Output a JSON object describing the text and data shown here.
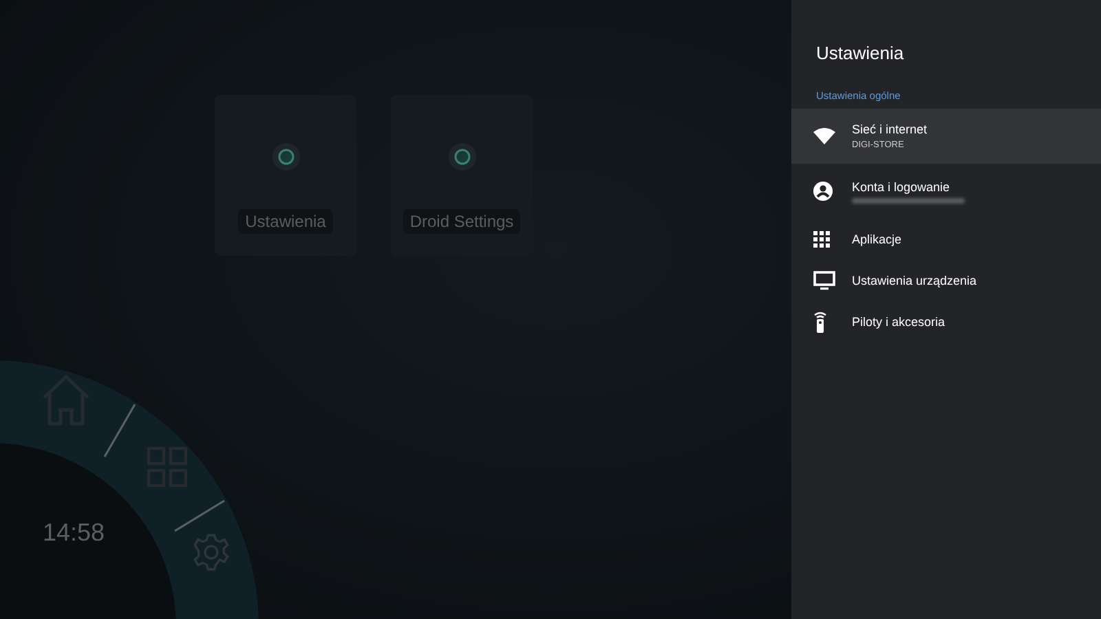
{
  "apps": [
    {
      "label": "Ustawienia"
    },
    {
      "label": "Droid Settings"
    }
  ],
  "radial_menu": {
    "clock": "14:58"
  },
  "settings": {
    "title": "Ustawienia",
    "section": "Ustawienia ogólne",
    "items": [
      {
        "kind": "wifi",
        "label": "Sieć i internet",
        "subtitle": "DIGI-STORE",
        "selected": true
      },
      {
        "kind": "account",
        "label": "Konta i logowanie",
        "redacted_subtitle": true,
        "selected": false
      },
      {
        "kind": "apps",
        "label": "Aplikacje",
        "selected": false
      },
      {
        "kind": "tv",
        "label": "Ustawienia urządzenia",
        "selected": false
      },
      {
        "kind": "remote",
        "label": "Piloty i akcesoria",
        "selected": false
      }
    ]
  }
}
